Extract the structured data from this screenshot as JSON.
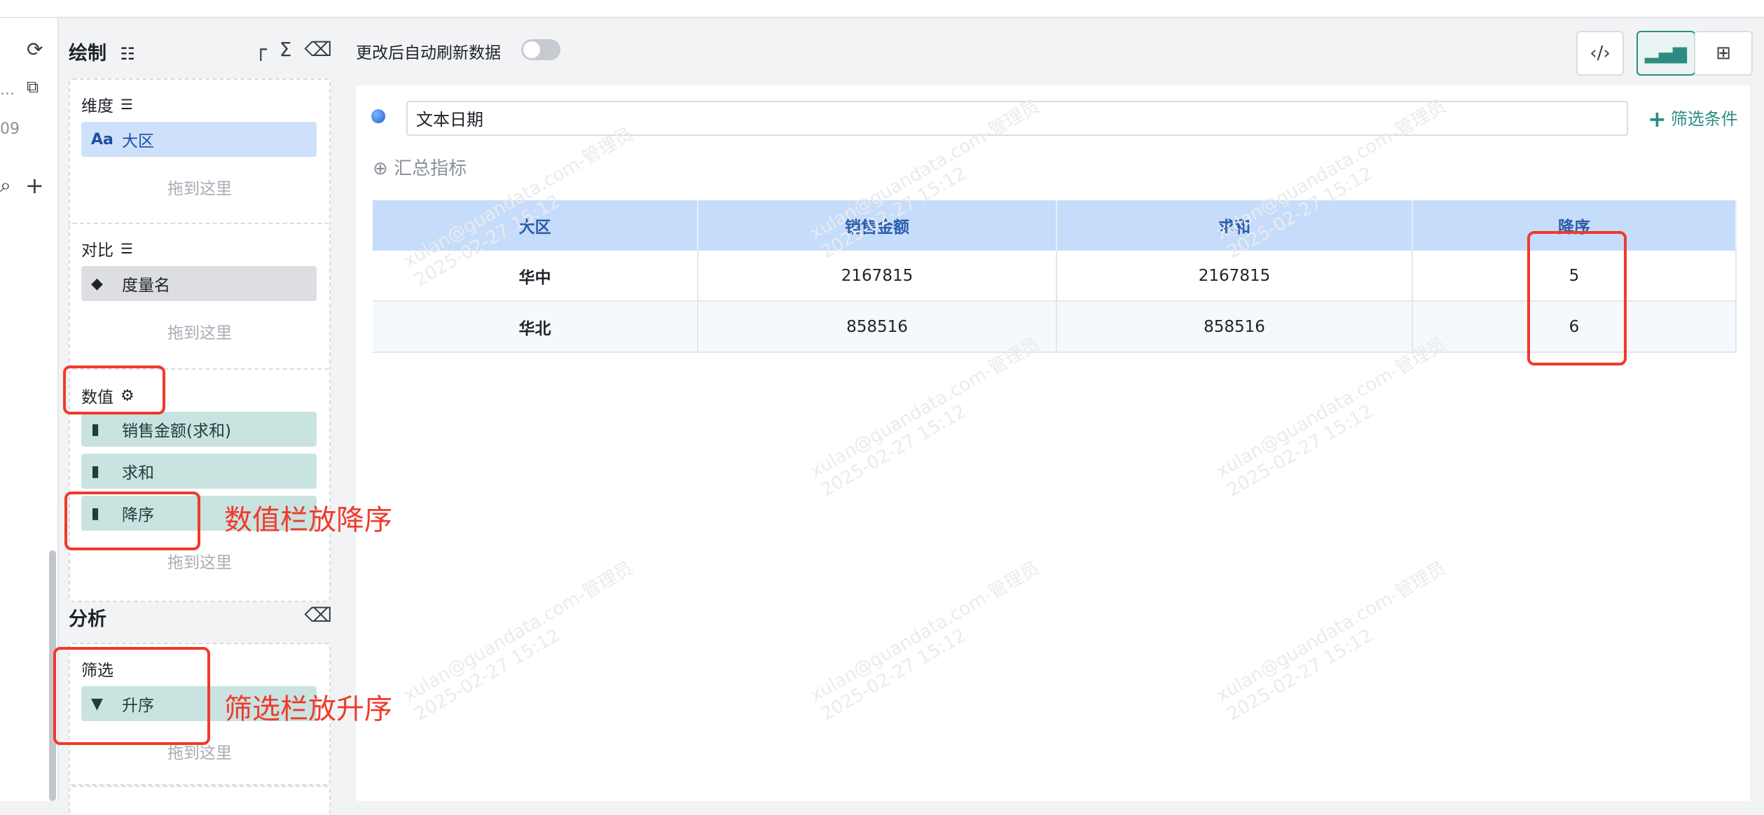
{
  "left_strip": {
    "text1": "...",
    "text2": "09"
  },
  "panel": {
    "title": "绘制",
    "dimension": {
      "label": "维度",
      "pill_icon": "Aa",
      "pill": "大区",
      "drop": "拖到这里"
    },
    "compare": {
      "label": "对比",
      "pill": "度量名",
      "drop": "拖到这里"
    },
    "values": {
      "label": "数值",
      "pills": [
        "销售金额(求和)",
        "求和",
        "降序"
      ],
      "drop": "拖到这里"
    },
    "analysis_title": "分析",
    "filter": {
      "label": "筛选",
      "pill": "升序",
      "drop": "拖到这里"
    }
  },
  "main": {
    "toggle_label": "更改后自动刷新数据",
    "toggle_on": false,
    "filter_field": "文本日期",
    "add_filter": "筛选条件",
    "summary": "汇总指标",
    "table": {
      "headers": [
        "大区",
        "销售金额",
        "求和",
        "降序"
      ],
      "rows": [
        [
          "华中",
          "2167815",
          "2167815",
          "5"
        ],
        [
          "华北",
          "858516",
          "858516",
          "6"
        ]
      ]
    }
  },
  "annotations": {
    "values_note": "数值栏放降序",
    "filter_note": "筛选栏放升序"
  },
  "watermark": {
    "line1": "xulan@guandata.com-管理员",
    "line2": "2025-02-27 15:12"
  },
  "colors": {
    "accent": "#2c8c82",
    "annotation": "#f03a2a",
    "header_bg": "#c6dcfb"
  }
}
